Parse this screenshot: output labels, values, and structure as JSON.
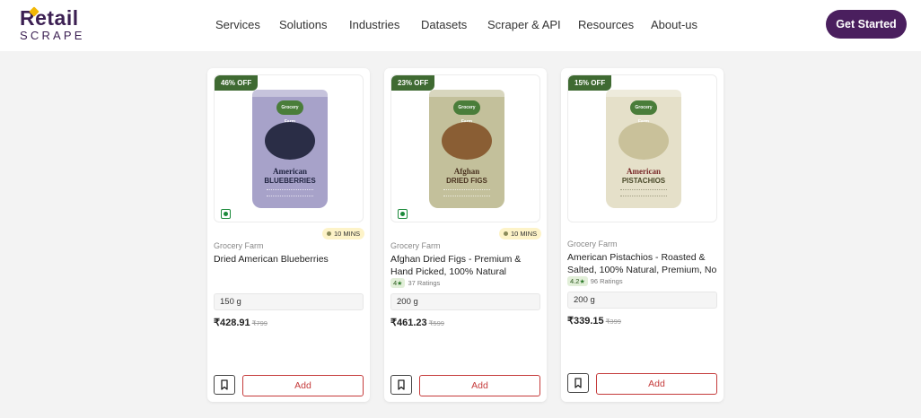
{
  "logo": {
    "top": "Retail",
    "bottom": "SCRAPE"
  },
  "nav": {
    "items": [
      {
        "label": "Services"
      },
      {
        "label": "Solutions"
      },
      {
        "label": "Industries"
      },
      {
        "label": "Datasets"
      },
      {
        "label": "Scraper & API"
      },
      {
        "label": "Resources"
      },
      {
        "label": "About-us"
      }
    ]
  },
  "cta": {
    "label": "Get Started"
  },
  "colors": {
    "brand": "#4a1f5e",
    "discount": "#3f6a32",
    "add": "#c53b3b",
    "eta_bg": "#fdf3c8"
  },
  "products": [
    {
      "discount": "46% OFF",
      "eta": "10 MINS",
      "brand": "Grocery Farm",
      "title": "Dried American Blueberries",
      "rating": null,
      "quantity": "150 g",
      "price": "₹428.91",
      "mrp": "₹799",
      "add_label": "Add",
      "pack": {
        "brand_text": "Grocery Farm",
        "line1": "American",
        "line2": "BLUEBERRIES",
        "color": "#a7a2c9",
        "fruit_color": "#2a2d46"
      }
    },
    {
      "discount": "23% OFF",
      "eta": "10 MINS",
      "brand": "Grocery Farm",
      "title": "Afghan Dried Figs - Premium & Hand Picked, 100% Natural",
      "rating": {
        "value": "4",
        "count": "37 Ratings"
      },
      "quantity": "200 g",
      "price": "₹461.23",
      "mrp": "₹599",
      "add_label": "Add",
      "pack": {
        "brand_text": "Grocery Farm",
        "line1": "Afghan",
        "line2": "DRIED FIGS",
        "color": "#c3c09b",
        "fruit_color": "#8a5e34"
      }
    },
    {
      "discount": "15% OFF",
      "eta": null,
      "brand": "Grocery Farm",
      "title": "American Pistachios - Roasted & Salted, 100% Natural, Premium, No",
      "rating": {
        "value": "4.2",
        "count": "96 Ratings"
      },
      "quantity": "200 g",
      "price": "₹339.15",
      "mrp": "₹399",
      "add_label": "Add",
      "pack": {
        "brand_text": "Grocery Farm",
        "line1": "American",
        "line2": "PISTACHIOS",
        "color": "#e5e0c9",
        "fruit_color": "#c9c19a"
      }
    }
  ]
}
